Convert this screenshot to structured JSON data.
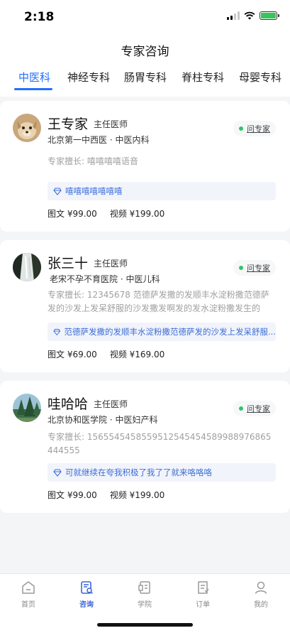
{
  "status_bar": {
    "time": "2:18"
  },
  "header": {
    "title": "专家咨询"
  },
  "tabs": [
    {
      "label": "中医科",
      "active": true
    },
    {
      "label": "神经专科",
      "active": false
    },
    {
      "label": "肠胃专科",
      "active": false
    },
    {
      "label": "脊柱专科",
      "active": false
    },
    {
      "label": "母婴专科",
      "active": false
    }
  ],
  "doctors": [
    {
      "name": "王专家",
      "title": "主任医师",
      "hospital": "北京第一中西医 · 中医内科",
      "skill": "专家擅长: 嘻嘻嘻嘻语音",
      "tag": "嘻嘻嘻嘻嘻嘻嘻",
      "price_text": "图文 ¥99.00",
      "price_video": "视频 ¥199.00",
      "ask_label": "问专家",
      "avatar_icon": "dog-avatar-icon"
    },
    {
      "name": "张三十",
      "title": "主任医师",
      "hospital": "老宋不孕不育医院 · 中医儿科",
      "skill": "专家擅长: 12345678 范德萨发撒的发顺丰水淀粉撒范德萨发的沙发上发呆舒服的沙发撒发啊发的发水淀粉撒发生的分...",
      "tag": "范德萨发撒的发顺丰水淀粉撒范德萨发的沙发上发呆舒服...",
      "price_text": "图文 ¥69.00",
      "price_video": "视频 ¥169.00",
      "ask_label": "问专家",
      "avatar_icon": "waterfall-avatar-icon"
    },
    {
      "name": "哇哈哈",
      "title": "主任医师",
      "hospital": "北京协和医学院 · 中医妇产科",
      "skill": "专家擅长: 1565545458559512545454589988976865444555",
      "tag": "可就继续在夸我积极了我了了就来咯咯咯",
      "price_text": "图文 ¥99.00",
      "price_video": "视频 ¥199.00",
      "ask_label": "问专家",
      "avatar_icon": "forest-avatar-icon"
    }
  ],
  "tabbar": [
    {
      "label": "首页",
      "icon": "home-icon",
      "active": false
    },
    {
      "label": "咨询",
      "icon": "consult-icon",
      "active": true
    },
    {
      "label": "学院",
      "icon": "college-icon",
      "active": false
    },
    {
      "label": "订单",
      "icon": "order-icon",
      "active": false
    },
    {
      "label": "我的",
      "icon": "profile-icon",
      "active": false
    }
  ],
  "colors": {
    "accent": "#1f6fff",
    "tag_text": "#3b6dd6",
    "online_dot": "#2fc46a",
    "background": "#f4f5f7"
  }
}
